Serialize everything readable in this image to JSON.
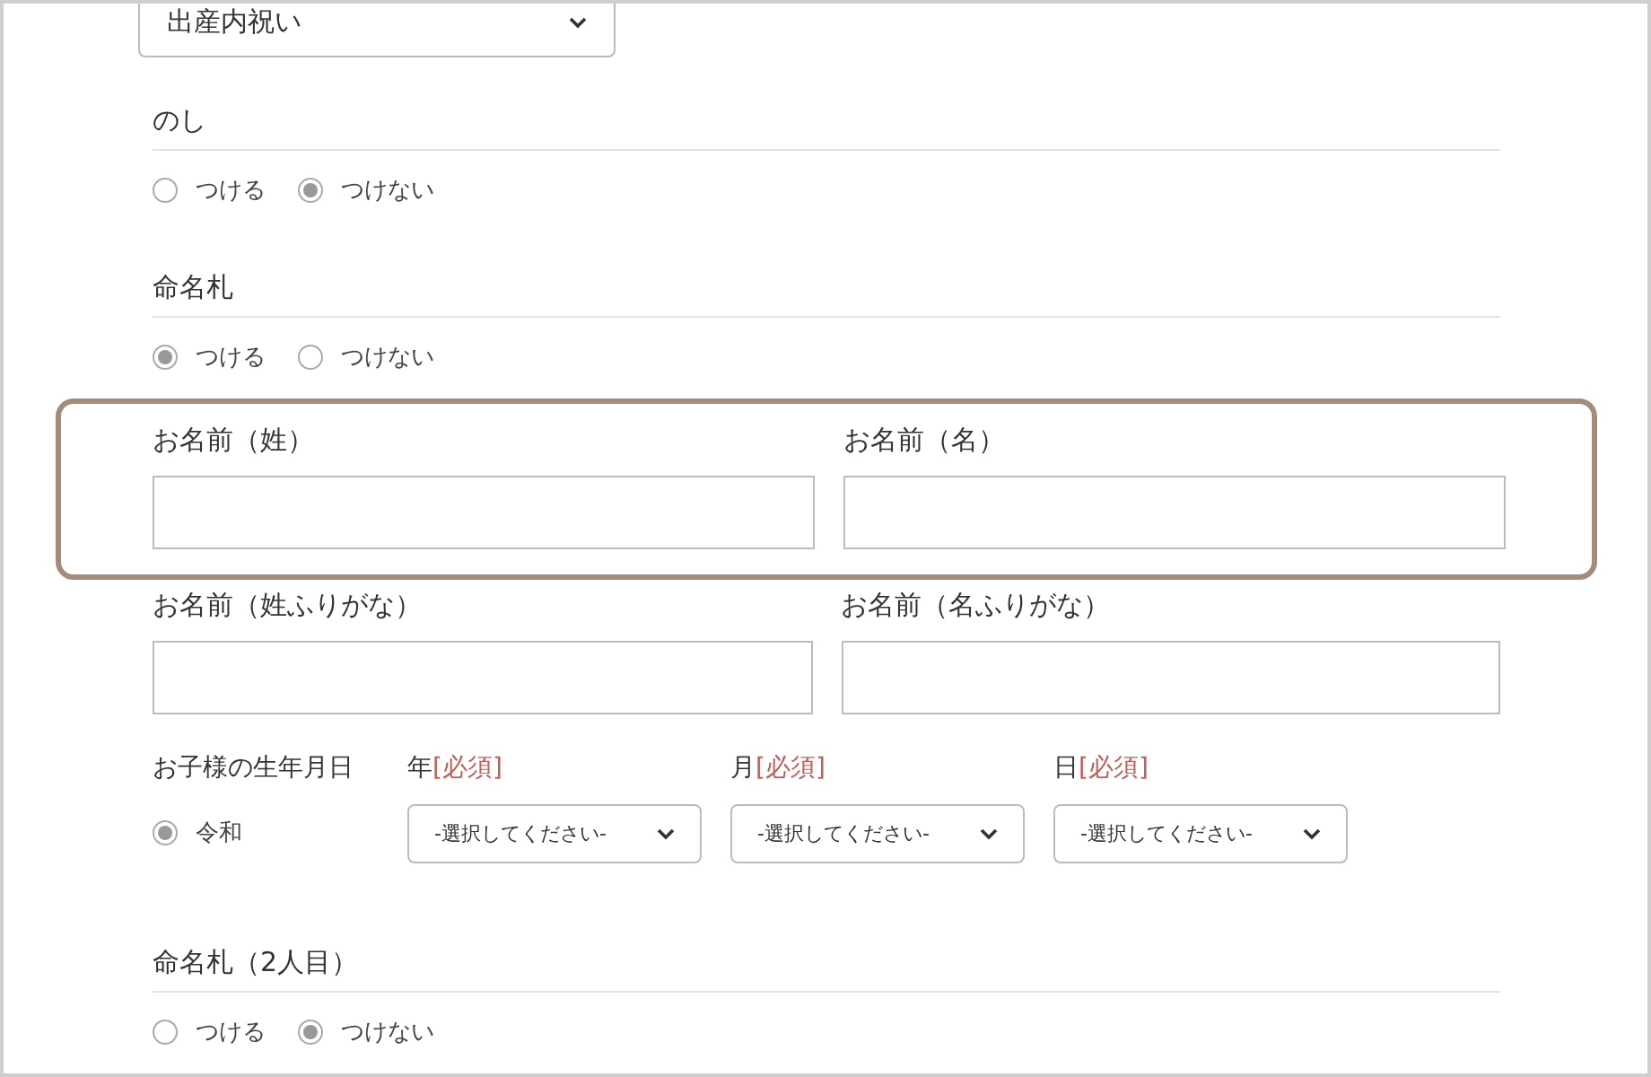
{
  "occasion_select": {
    "value": "出産内祝い"
  },
  "option_sections": [
    {
      "title": "のし",
      "options": [
        {
          "label": "つける",
          "selected": false
        },
        {
          "label": "つけない",
          "selected": true
        }
      ]
    },
    {
      "title": "命名札",
      "options": [
        {
          "label": "つける",
          "selected": true
        },
        {
          "label": "つけない",
          "selected": false
        }
      ]
    }
  ],
  "name_rows": [
    {
      "highlighted": true,
      "fields": [
        {
          "label": "お名前（姓）"
        },
        {
          "label": "お名前（名）"
        }
      ]
    },
    {
      "highlighted": false,
      "fields": [
        {
          "label": "お名前（姓ふりがな）"
        },
        {
          "label": "お名前（名ふりがな）"
        }
      ]
    }
  ],
  "birthdate": {
    "label": "お子様の生年月日",
    "era": {
      "label": "令和",
      "selected": true
    },
    "selects": [
      {
        "label": "年",
        "required": "[必須]",
        "value": "-選択してください-"
      },
      {
        "label": "月",
        "required": "[必須]",
        "value": "-選択してください-"
      },
      {
        "label": "日",
        "required": "[必須]",
        "value": "-選択してください-"
      }
    ]
  },
  "second_tag_section": {
    "title": "命名札（2人目）",
    "options": [
      {
        "label": "つける",
        "selected": false
      },
      {
        "label": "つけない",
        "selected": true
      }
    ]
  }
}
